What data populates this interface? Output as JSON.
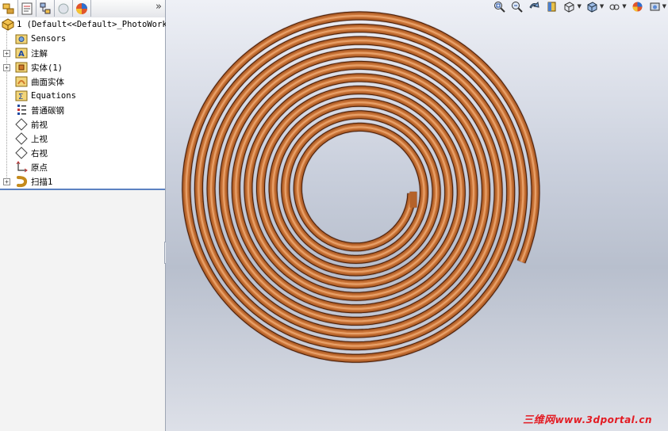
{
  "feature_manager": {
    "tabs": [
      {
        "name": "featuremanager-tree-tab",
        "icon": "feature-tree-icon"
      },
      {
        "name": "propertymanager-tab",
        "icon": "property-manager-icon"
      },
      {
        "name": "configurationmanager-tab",
        "icon": "configuration-manager-icon"
      },
      {
        "name": "dimxpert-tab",
        "icon": "dimxpert-icon"
      },
      {
        "name": "display-manager-tab",
        "icon": "display-manager-icon"
      }
    ],
    "more_glyph": "»",
    "tree": {
      "root_label": "1  (Default<<Default>_PhotoWork",
      "items": [
        {
          "label": "Sensors",
          "icon": "sensors-folder-icon",
          "expandable": false
        },
        {
          "label": "注解",
          "icon": "annotations-icon",
          "expandable": true
        },
        {
          "label": "实体(1)",
          "icon": "solid-bodies-icon",
          "expandable": true
        },
        {
          "label": "曲面实体",
          "icon": "surface-bodies-icon",
          "expandable": false
        },
        {
          "label": "Equations",
          "icon": "equations-icon",
          "expandable": false
        },
        {
          "label": "普通碳钢",
          "icon": "material-icon",
          "expandable": false
        },
        {
          "label": "前视",
          "icon": "plane-icon",
          "expandable": false
        },
        {
          "label": "上视",
          "icon": "plane-icon",
          "expandable": false
        },
        {
          "label": "右视",
          "icon": "plane-icon",
          "expandable": false
        },
        {
          "label": "原点",
          "icon": "origin-icon",
          "expandable": false
        },
        {
          "label": "扫描1",
          "icon": "sweep-feature-icon",
          "expandable": true
        }
      ]
    }
  },
  "view_toolbar": [
    "zoom-to-fit-icon",
    "zoom-to-area-icon",
    "previous-view-icon",
    "section-view-icon",
    "view-orientation-icon",
    "display-style-icon",
    "hide-show-items-icon",
    "edit-appearance-icon",
    "apply-scene-icon"
  ],
  "watermark": {
    "text_cn": "三维网",
    "text_url": "www.3dportal.cn"
  },
  "colors": {
    "copper": "#b4622c",
    "selection_line": "#5c82c2",
    "watermark": "#e31b23"
  }
}
